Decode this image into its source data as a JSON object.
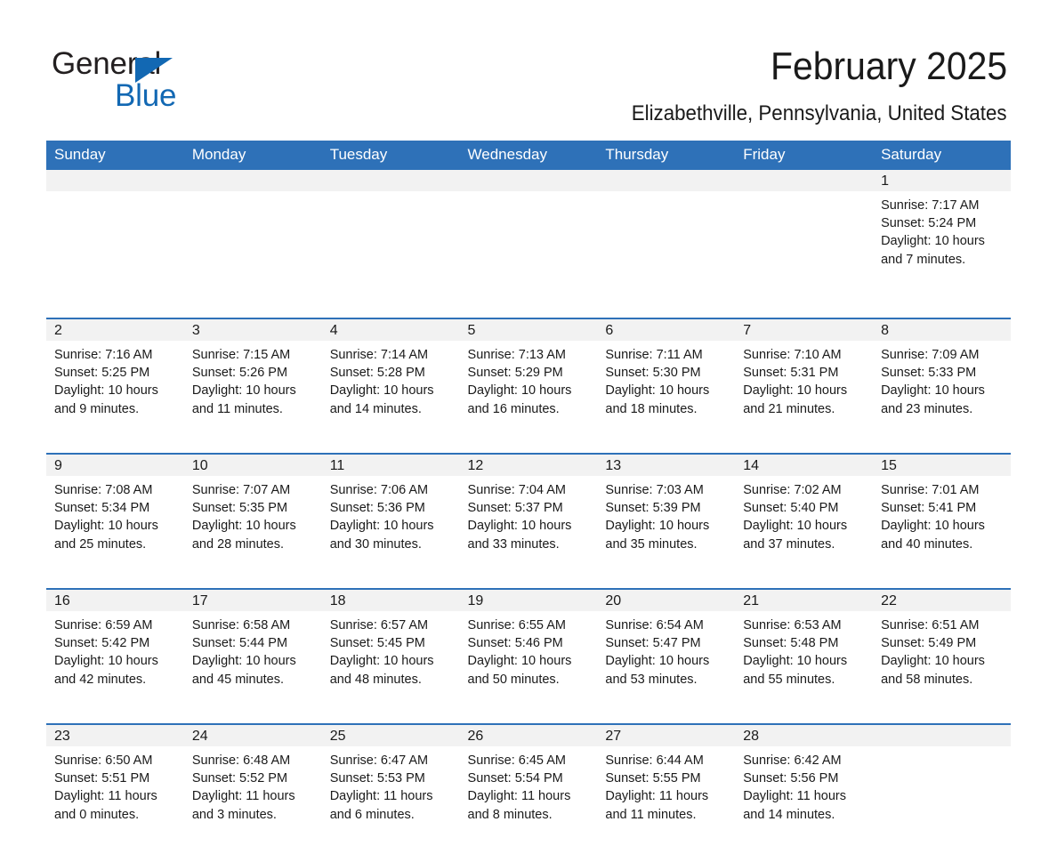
{
  "brand": {
    "name_part1": "General",
    "name_part2": "Blue",
    "accent_color": "#1268b3"
  },
  "header": {
    "title": "February 2025",
    "subtitle": "Elizabethville, Pennsylvania, United States"
  },
  "theme": {
    "header_blue": "#2e71b8",
    "daynum_gray": "#f2f2f2"
  },
  "calendar": {
    "weekdays": [
      "Sunday",
      "Monday",
      "Tuesday",
      "Wednesday",
      "Thursday",
      "Friday",
      "Saturday"
    ],
    "weeks": [
      [
        {
          "day": "",
          "lines": []
        },
        {
          "day": "",
          "lines": []
        },
        {
          "day": "",
          "lines": []
        },
        {
          "day": "",
          "lines": []
        },
        {
          "day": "",
          "lines": []
        },
        {
          "day": "",
          "lines": []
        },
        {
          "day": "1",
          "lines": [
            "Sunrise: 7:17 AM",
            "Sunset: 5:24 PM",
            "Daylight: 10 hours",
            "and 7 minutes."
          ]
        }
      ],
      [
        {
          "day": "2",
          "lines": [
            "Sunrise: 7:16 AM",
            "Sunset: 5:25 PM",
            "Daylight: 10 hours",
            "and 9 minutes."
          ]
        },
        {
          "day": "3",
          "lines": [
            "Sunrise: 7:15 AM",
            "Sunset: 5:26 PM",
            "Daylight: 10 hours",
            "and 11 minutes."
          ]
        },
        {
          "day": "4",
          "lines": [
            "Sunrise: 7:14 AM",
            "Sunset: 5:28 PM",
            "Daylight: 10 hours",
            "and 14 minutes."
          ]
        },
        {
          "day": "5",
          "lines": [
            "Sunrise: 7:13 AM",
            "Sunset: 5:29 PM",
            "Daylight: 10 hours",
            "and 16 minutes."
          ]
        },
        {
          "day": "6",
          "lines": [
            "Sunrise: 7:11 AM",
            "Sunset: 5:30 PM",
            "Daylight: 10 hours",
            "and 18 minutes."
          ]
        },
        {
          "day": "7",
          "lines": [
            "Sunrise: 7:10 AM",
            "Sunset: 5:31 PM",
            "Daylight: 10 hours",
            "and 21 minutes."
          ]
        },
        {
          "day": "8",
          "lines": [
            "Sunrise: 7:09 AM",
            "Sunset: 5:33 PM",
            "Daylight: 10 hours",
            "and 23 minutes."
          ]
        }
      ],
      [
        {
          "day": "9",
          "lines": [
            "Sunrise: 7:08 AM",
            "Sunset: 5:34 PM",
            "Daylight: 10 hours",
            "and 25 minutes."
          ]
        },
        {
          "day": "10",
          "lines": [
            "Sunrise: 7:07 AM",
            "Sunset: 5:35 PM",
            "Daylight: 10 hours",
            "and 28 minutes."
          ]
        },
        {
          "day": "11",
          "lines": [
            "Sunrise: 7:06 AM",
            "Sunset: 5:36 PM",
            "Daylight: 10 hours",
            "and 30 minutes."
          ]
        },
        {
          "day": "12",
          "lines": [
            "Sunrise: 7:04 AM",
            "Sunset: 5:37 PM",
            "Daylight: 10 hours",
            "and 33 minutes."
          ]
        },
        {
          "day": "13",
          "lines": [
            "Sunrise: 7:03 AM",
            "Sunset: 5:39 PM",
            "Daylight: 10 hours",
            "and 35 minutes."
          ]
        },
        {
          "day": "14",
          "lines": [
            "Sunrise: 7:02 AM",
            "Sunset: 5:40 PM",
            "Daylight: 10 hours",
            "and 37 minutes."
          ]
        },
        {
          "day": "15",
          "lines": [
            "Sunrise: 7:01 AM",
            "Sunset: 5:41 PM",
            "Daylight: 10 hours",
            "and 40 minutes."
          ]
        }
      ],
      [
        {
          "day": "16",
          "lines": [
            "Sunrise: 6:59 AM",
            "Sunset: 5:42 PM",
            "Daylight: 10 hours",
            "and 42 minutes."
          ]
        },
        {
          "day": "17",
          "lines": [
            "Sunrise: 6:58 AM",
            "Sunset: 5:44 PM",
            "Daylight: 10 hours",
            "and 45 minutes."
          ]
        },
        {
          "day": "18",
          "lines": [
            "Sunrise: 6:57 AM",
            "Sunset: 5:45 PM",
            "Daylight: 10 hours",
            "and 48 minutes."
          ]
        },
        {
          "day": "19",
          "lines": [
            "Sunrise: 6:55 AM",
            "Sunset: 5:46 PM",
            "Daylight: 10 hours",
            "and 50 minutes."
          ]
        },
        {
          "day": "20",
          "lines": [
            "Sunrise: 6:54 AM",
            "Sunset: 5:47 PM",
            "Daylight: 10 hours",
            "and 53 minutes."
          ]
        },
        {
          "day": "21",
          "lines": [
            "Sunrise: 6:53 AM",
            "Sunset: 5:48 PM",
            "Daylight: 10 hours",
            "and 55 minutes."
          ]
        },
        {
          "day": "22",
          "lines": [
            "Sunrise: 6:51 AM",
            "Sunset: 5:49 PM",
            "Daylight: 10 hours",
            "and 58 minutes."
          ]
        }
      ],
      [
        {
          "day": "23",
          "lines": [
            "Sunrise: 6:50 AM",
            "Sunset: 5:51 PM",
            "Daylight: 11 hours",
            "and 0 minutes."
          ]
        },
        {
          "day": "24",
          "lines": [
            "Sunrise: 6:48 AM",
            "Sunset: 5:52 PM",
            "Daylight: 11 hours",
            "and 3 minutes."
          ]
        },
        {
          "day": "25",
          "lines": [
            "Sunrise: 6:47 AM",
            "Sunset: 5:53 PM",
            "Daylight: 11 hours",
            "and 6 minutes."
          ]
        },
        {
          "day": "26",
          "lines": [
            "Sunrise: 6:45 AM",
            "Sunset: 5:54 PM",
            "Daylight: 11 hours",
            "and 8 minutes."
          ]
        },
        {
          "day": "27",
          "lines": [
            "Sunrise: 6:44 AM",
            "Sunset: 5:55 PM",
            "Daylight: 11 hours",
            "and 11 minutes."
          ]
        },
        {
          "day": "28",
          "lines": [
            "Sunrise: 6:42 AM",
            "Sunset: 5:56 PM",
            "Daylight: 11 hours",
            "and 14 minutes."
          ]
        },
        {
          "day": "",
          "lines": []
        }
      ]
    ]
  }
}
